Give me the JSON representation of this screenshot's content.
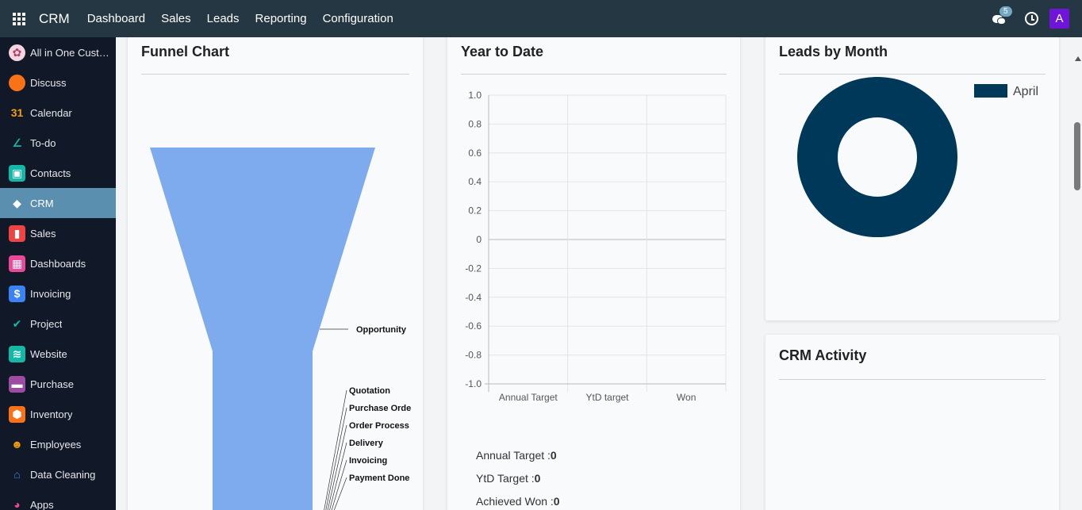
{
  "navbar": {
    "brand": "CRM",
    "menu": [
      "Dashboard",
      "Sales",
      "Leads",
      "Reporting",
      "Configuration"
    ],
    "chat_badge": "5",
    "avatar_letter": "A",
    "avatar_color": "#6f14d9"
  },
  "sidebar": {
    "items": [
      {
        "label": "All in One Cust…",
        "icon": "customer-icon",
        "color": "#f3d6e0"
      },
      {
        "label": "Discuss",
        "icon": "discuss-icon",
        "color": "#f97316"
      },
      {
        "label": "Calendar",
        "icon": "calendar-icon",
        "color": "#111827"
      },
      {
        "label": "To-do",
        "icon": "todo-icon",
        "color": "#111827"
      },
      {
        "label": "Contacts",
        "icon": "contacts-icon",
        "color": "#14b8a6"
      },
      {
        "label": "CRM",
        "icon": "crm-icon",
        "color": "#5b8fb0",
        "active": true
      },
      {
        "label": "Sales",
        "icon": "sales-icon",
        "color": "#ef4444"
      },
      {
        "label": "Dashboards",
        "icon": "dashboards-icon",
        "color": "#ec4899"
      },
      {
        "label": "Invoicing",
        "icon": "invoicing-icon",
        "color": "#3b82f6"
      },
      {
        "label": "Project",
        "icon": "project-icon",
        "color": "#111827"
      },
      {
        "label": "Website",
        "icon": "website-icon",
        "color": "#14b8a6"
      },
      {
        "label": "Purchase",
        "icon": "purchase-icon",
        "color": "#9d4ba3"
      },
      {
        "label": "Inventory",
        "icon": "inventory-icon",
        "color": "#f97316"
      },
      {
        "label": "Employees",
        "icon": "employees-icon",
        "color": "#111827"
      },
      {
        "label": "Data Cleaning",
        "icon": "data-cleaning-icon",
        "color": "#111827"
      },
      {
        "label": "Apps",
        "icon": "apps-icon",
        "color": "#111827"
      }
    ]
  },
  "funnel": {
    "title": "Funnel Chart",
    "color": "#7eabee",
    "stages": [
      "Opportunity",
      "Quotation",
      "Purchase Orde",
      "Order Process",
      "Delivery",
      "Invoicing",
      "Payment Done"
    ]
  },
  "ytd": {
    "title": "Year to Date",
    "stats": [
      {
        "label": "Annual Target :",
        "value": "0"
      },
      {
        "label": "YtD Target :",
        "value": "0"
      },
      {
        "label": "Achieved Won :",
        "value": "0"
      }
    ]
  },
  "chart_data": [
    {
      "type": "bar",
      "title": "Year to Date",
      "categories": [
        "Annual Target",
        "YtD target",
        "Won"
      ],
      "values": [
        0,
        0,
        0
      ],
      "ylim": [
        -1.0,
        1.0
      ],
      "yticks": [
        "1.0",
        "0.8",
        "0.6",
        "0.4",
        "0.2",
        "0",
        "-0.2",
        "-0.4",
        "-0.6",
        "-0.8",
        "-1.0"
      ],
      "grid": true
    },
    {
      "type": "pie",
      "title": "Leads by Month",
      "categories": [
        "April"
      ],
      "values": [
        1
      ],
      "colors": [
        "#00385a"
      ],
      "legend": "top-right"
    }
  ],
  "leads": {
    "title": "Leads by Month",
    "legend": "April",
    "color": "#00385a"
  },
  "activity": {
    "title": "CRM Activity"
  }
}
